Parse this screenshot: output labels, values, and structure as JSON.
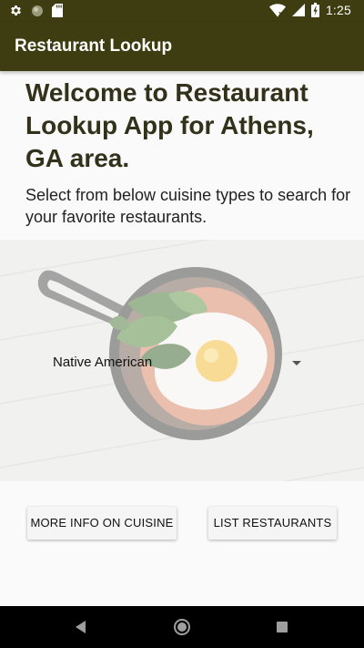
{
  "status_bar": {
    "time": "1:25",
    "left_icons": [
      "gear-icon",
      "circle-icon",
      "sd-card-icon"
    ],
    "right_icons": [
      "wifi-icon",
      "signal-icon",
      "battery-icon"
    ]
  },
  "app_bar": {
    "title": "Restaurant Lookup",
    "color": "#3e3c11"
  },
  "main": {
    "welcome": "Welcome to Restaurant Lookup App for Athens, GA area.",
    "subtitle": "Select from below cuisine types to search for your favorite restaurants.",
    "cuisine_spinner": {
      "selected": "Native American"
    },
    "buttons": {
      "more_info": "MORE INFO ON CUISINE",
      "list_restaurants": "LIST RESTAURANTS"
    }
  },
  "nav_bar": {
    "icons": [
      "back-icon",
      "home-icon",
      "recents-icon"
    ]
  }
}
